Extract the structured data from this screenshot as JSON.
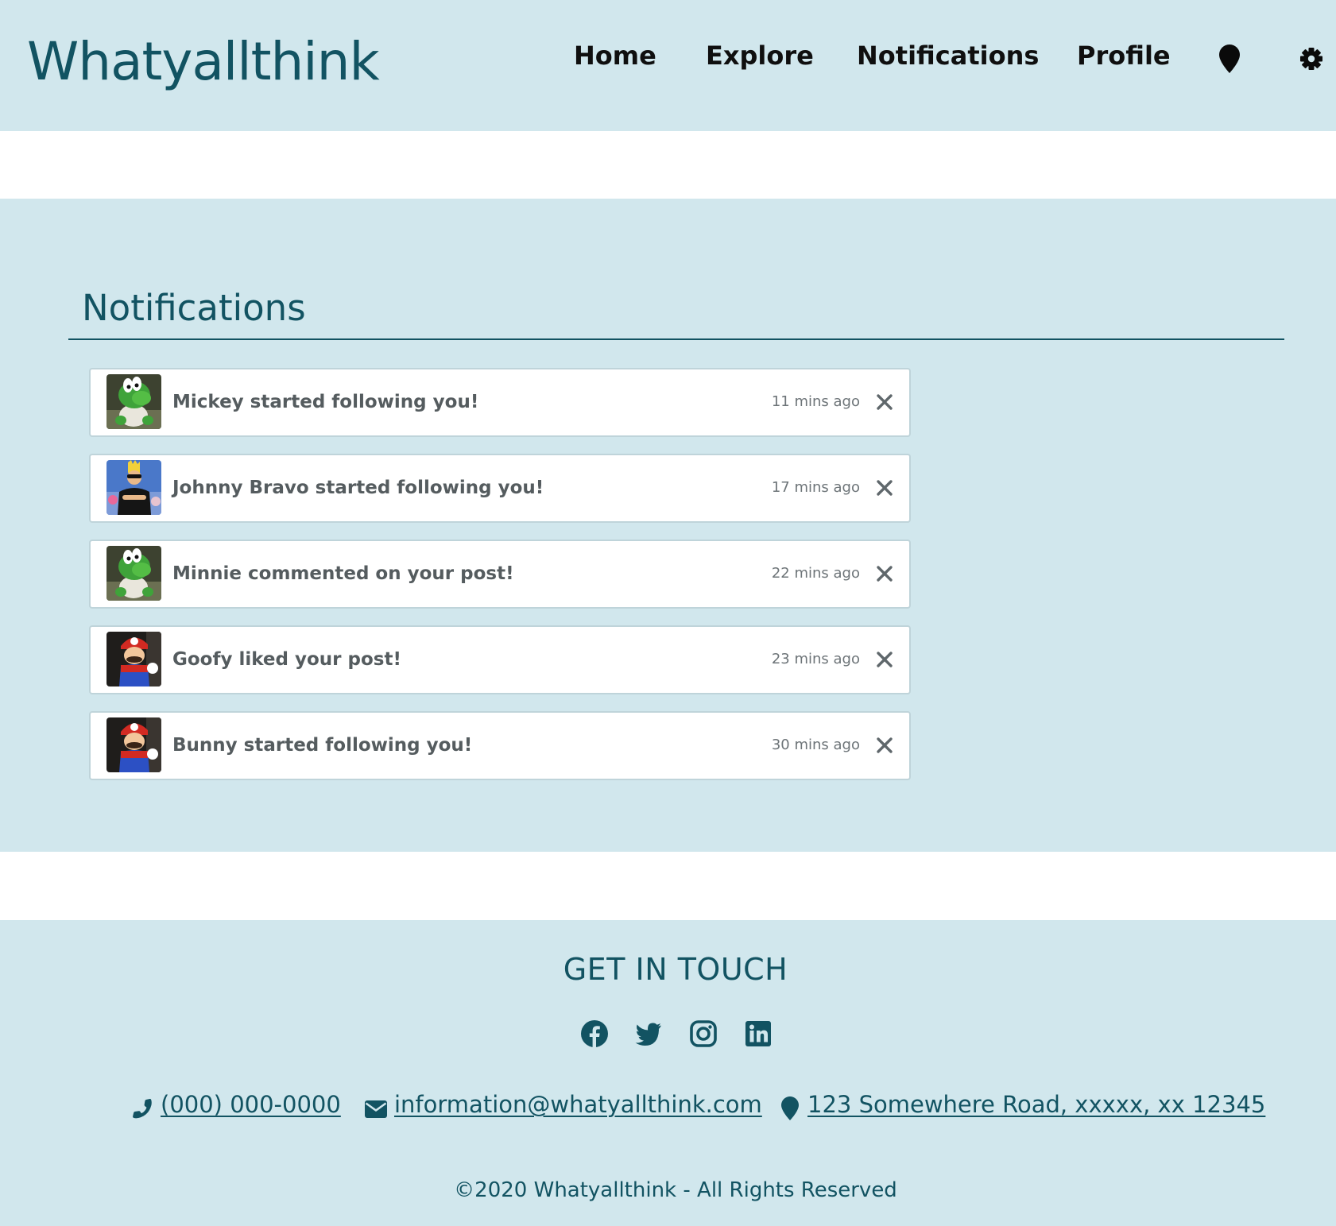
{
  "header": {
    "logo": "Whatyallthink",
    "nav": [
      {
        "label": "Home"
      },
      {
        "label": "Explore"
      },
      {
        "label": "Notifications"
      },
      {
        "label": "Profile"
      }
    ],
    "icons": [
      "location-pin-icon",
      "gear-icon"
    ]
  },
  "main": {
    "title": "Notifications",
    "notifications": [
      {
        "message": "Mickey started following you!",
        "time": "11 mins ago",
        "avatar": "yoshi"
      },
      {
        "message": "Johnny Bravo started following you!",
        "time": "17 mins ago",
        "avatar": "johnny-bravo"
      },
      {
        "message": "Minnie commented on your post!",
        "time": "22 mins ago",
        "avatar": "yoshi"
      },
      {
        "message": "Goofy liked your post!",
        "time": "23 mins ago",
        "avatar": "mario"
      },
      {
        "message": "Bunny started following you!",
        "time": "30 mins ago",
        "avatar": "mario"
      }
    ]
  },
  "footer": {
    "title": "GET IN TOUCH",
    "social": [
      "facebook-icon",
      "twitter-icon",
      "instagram-icon",
      "linkedin-icon"
    ],
    "phone": " (000) 000-0000",
    "email": " information@whatyallthink.com",
    "address": " 123 Somewhere Road, xxxxx, xx 12345",
    "copyright": "©2020 Whatyallthink - All Rights Reserved"
  },
  "colors": {
    "brand": "#125362",
    "panel_bg": "#d1e7ed",
    "nav_text": "#0f0f0f",
    "notification_text": "#555c5f"
  }
}
